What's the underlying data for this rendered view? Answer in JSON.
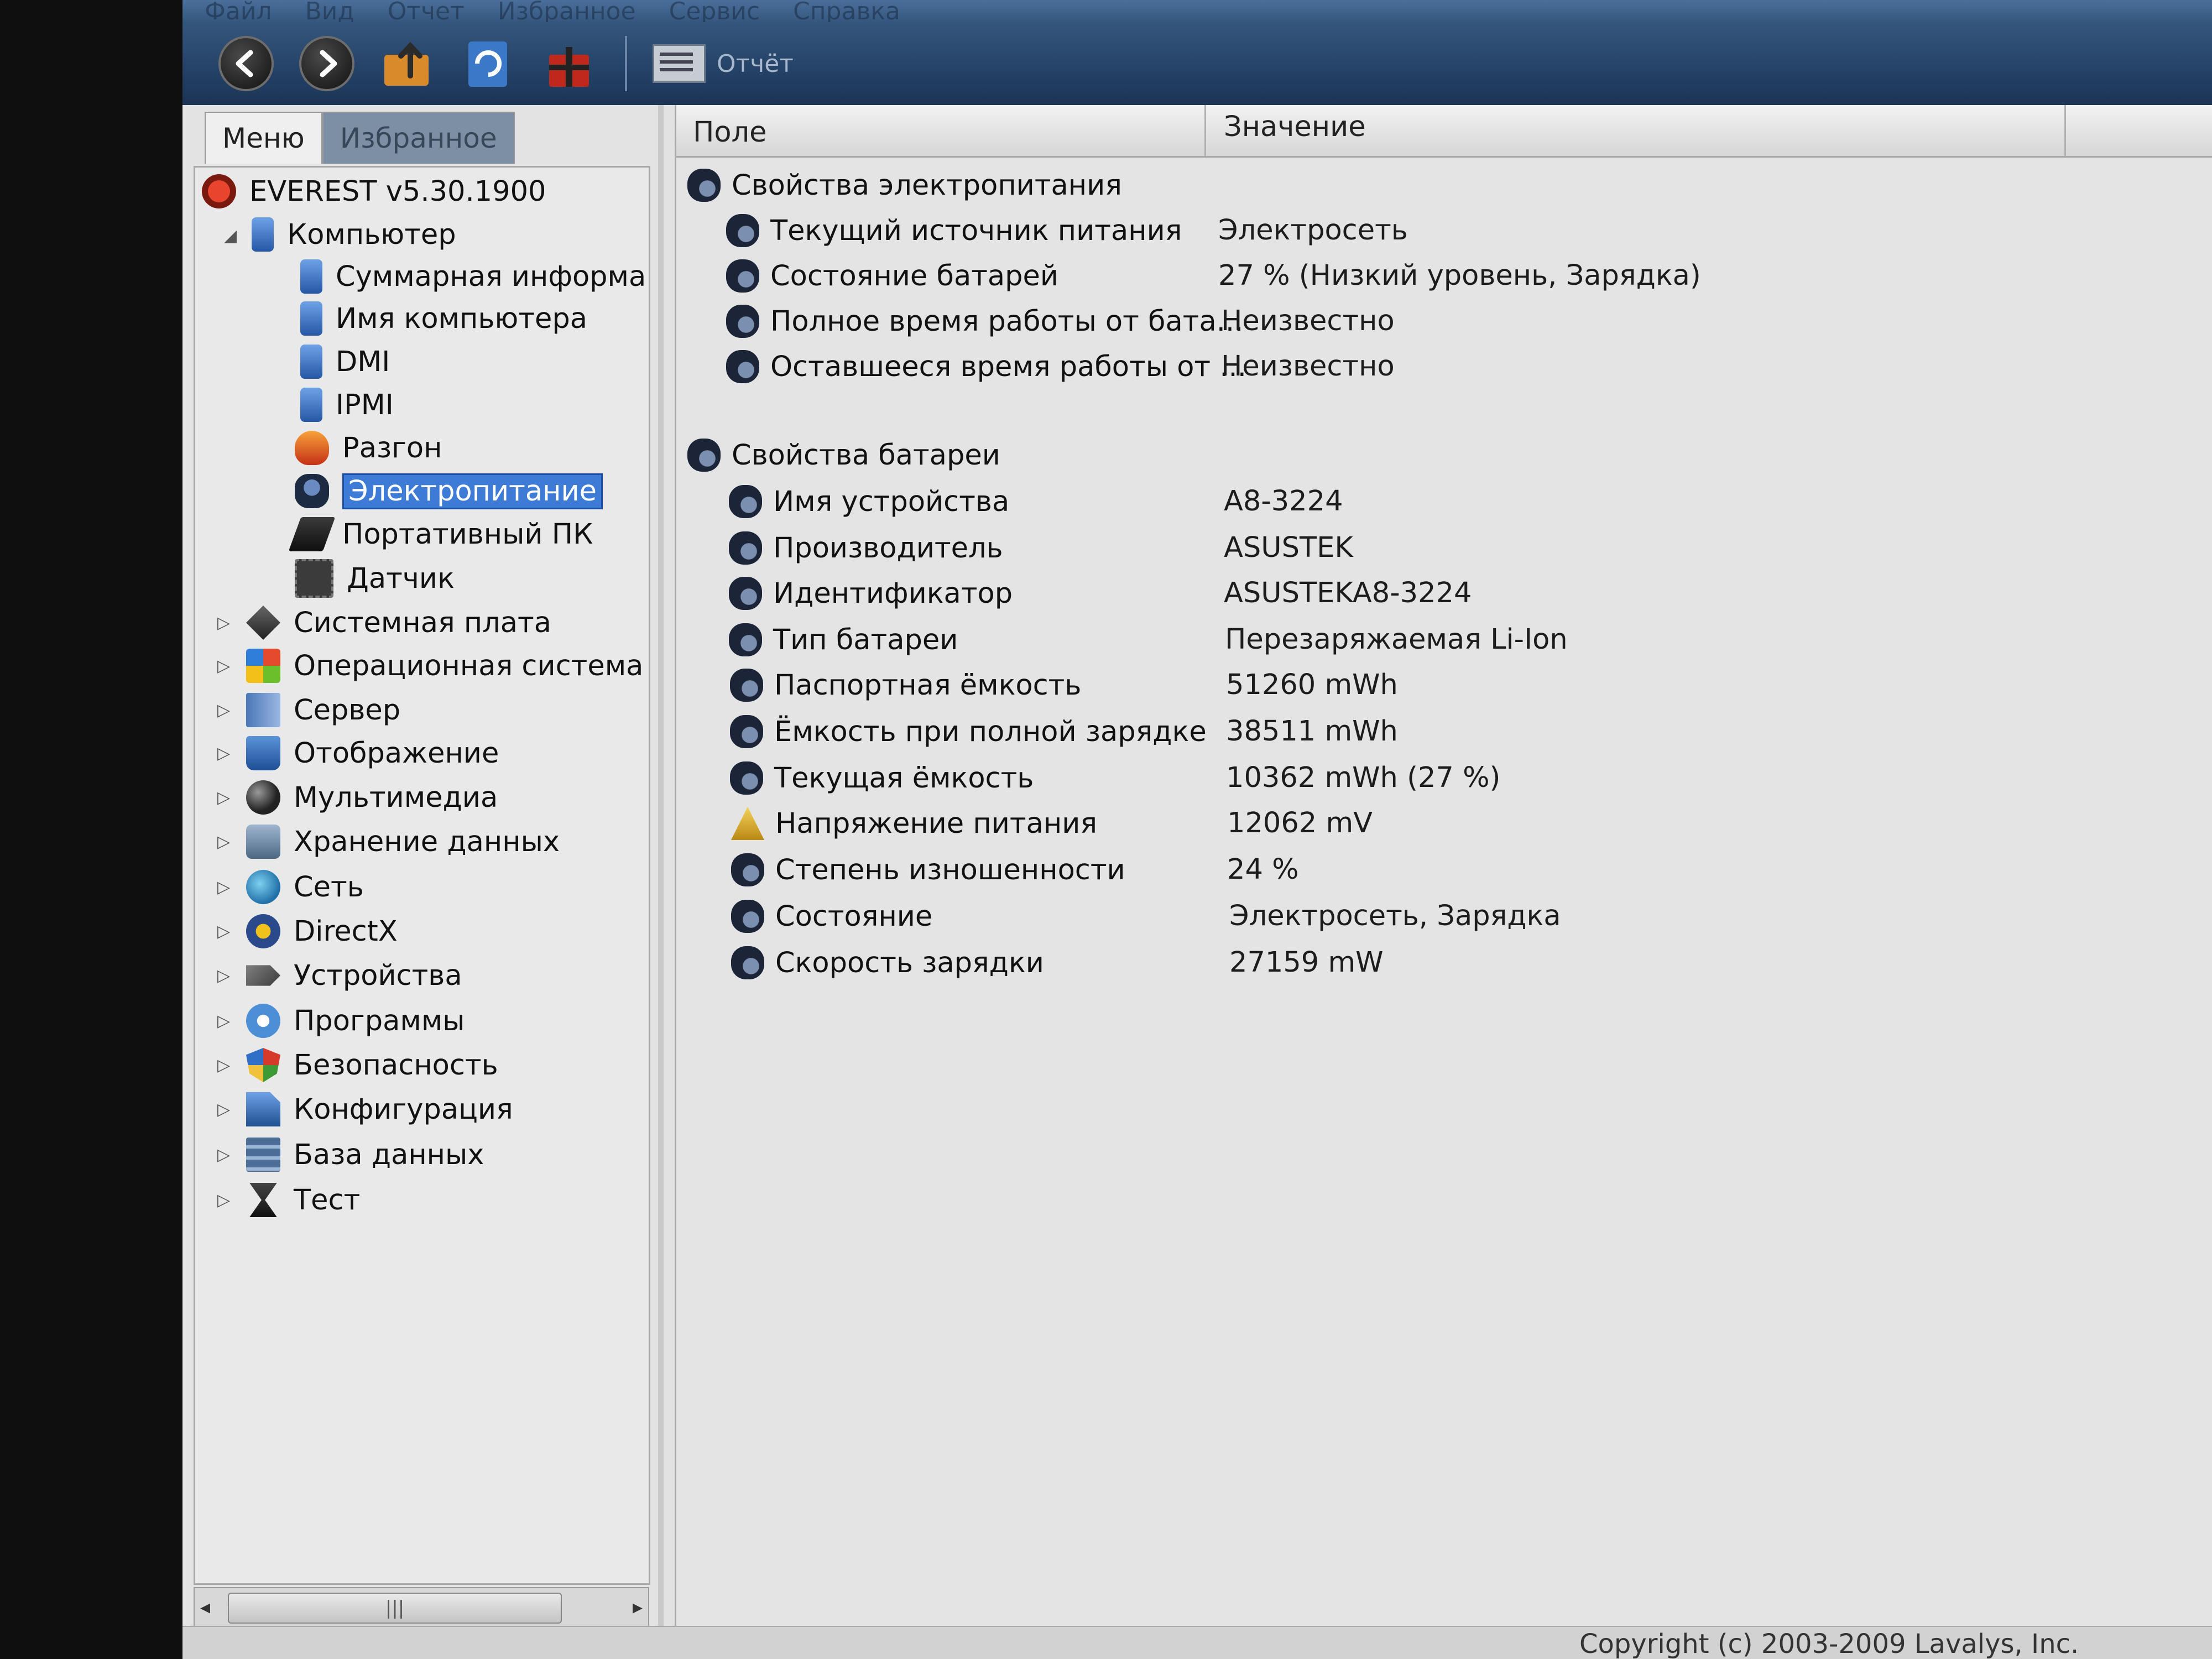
{
  "menubar": [
    "Файл",
    "Вид",
    "Отчет",
    "Избранное",
    "Сервис",
    "Справка"
  ],
  "toolbar": {
    "report_label": "Отчёт"
  },
  "tabs": {
    "menu": "Меню",
    "favorites": "Избранное"
  },
  "tree": {
    "root": "EVEREST v5.30.1900",
    "computer": "Компьютер",
    "computer_children": [
      "Суммарная информа",
      "Имя компьютера",
      "DMI",
      "IPMI",
      "Разгон",
      "Электропитание",
      "Портативный ПК",
      "Датчик"
    ],
    "categories": [
      "Системная плата",
      "Операционная система",
      "Сервер",
      "Отображение",
      "Мультимедиа",
      "Хранение данных",
      "Сеть",
      "DirectX",
      "Устройства",
      "Программы",
      "Безопасность",
      "Конфигурация",
      "База данных",
      "Тест"
    ]
  },
  "columns": {
    "field": "Поле",
    "value": "Значение"
  },
  "groups": [
    {
      "title": "Свойства электропитания",
      "rows": [
        {
          "field": "Текущий источник питания",
          "value": "Электросеть"
        },
        {
          "field": "Состояние батарей",
          "value": "27 % (Низкий уровень, Зарядка)"
        },
        {
          "field": "Полное время работы от бата...",
          "value": "Неизвестно"
        },
        {
          "field": "Оставшееся время работы от ...",
          "value": "Неизвестно"
        }
      ]
    },
    {
      "title": "Свойства батареи",
      "rows": [
        {
          "field": "Имя устройства",
          "value": "A8-3224"
        },
        {
          "field": "Производитель",
          "value": "ASUSTEK"
        },
        {
          "field": "Идентификатор",
          "value": "ASUSTEKA8-3224"
        },
        {
          "field": "Тип батареи",
          "value": "Перезаряжаемая Li-Ion"
        },
        {
          "field": "Паспортная ёмкость",
          "value": "51260 mWh"
        },
        {
          "field": "Ёмкость при полной зарядке",
          "value": "38511 mWh"
        },
        {
          "field": "Текущая ёмкость",
          "value": "10362 mWh  (27 %)"
        },
        {
          "field": "Напряжение питания",
          "value": "12062 mV"
        },
        {
          "field": "Степень изношенности",
          "value": "24 %"
        },
        {
          "field": "Состояние",
          "value": "Электросеть, Зарядка"
        },
        {
          "field": "Скорость зарядки",
          "value": "27159 mW"
        }
      ]
    }
  ],
  "statusbar": {
    "copyright": "Copyright (c) 2003-2009 Lavalys, Inc."
  }
}
